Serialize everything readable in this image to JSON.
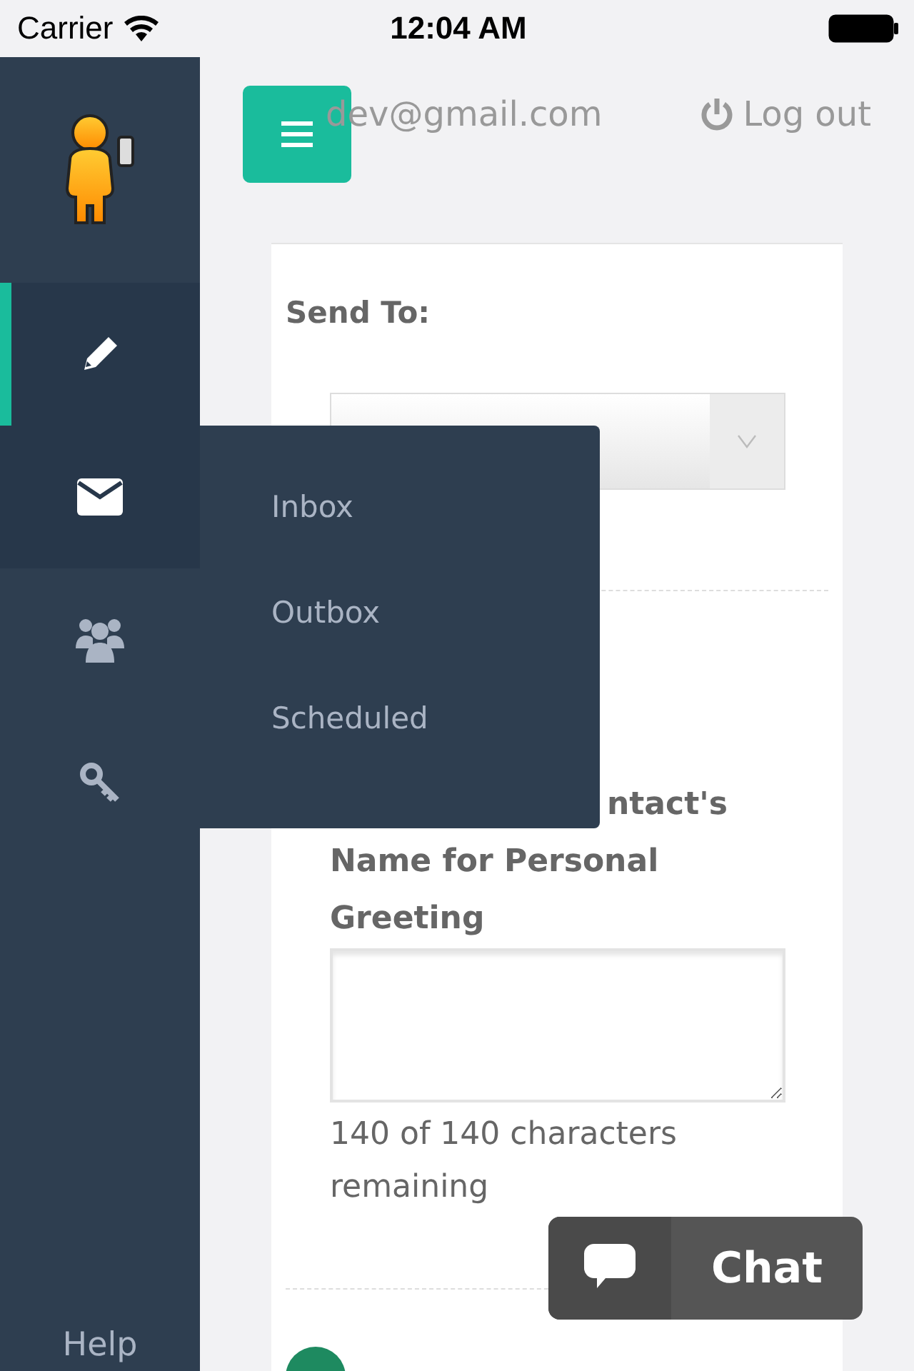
{
  "status_bar": {
    "carrier": "Carrier",
    "time": "12:04 AM"
  },
  "sidebar": {
    "items": [
      {
        "kind": "pencil",
        "selected": true,
        "expanded": false
      },
      {
        "kind": "envelope",
        "selected": false,
        "expanded": true
      },
      {
        "kind": "users",
        "selected": false,
        "expanded": false
      },
      {
        "kind": "key",
        "selected": false,
        "expanded": false
      }
    ],
    "help": "Help"
  },
  "flyout_menu": {
    "items": [
      "Inbox",
      "Outbox",
      "Scheduled"
    ]
  },
  "header": {
    "user_email": "dev@gmail.com",
    "logout": "Log out"
  },
  "form": {
    "send_to_label": "Send To:",
    "greeting_label": "ntact's Name for Personal Greeting",
    "counter": "140 of 140 characters remaining"
  },
  "chat": {
    "label": "Chat"
  }
}
